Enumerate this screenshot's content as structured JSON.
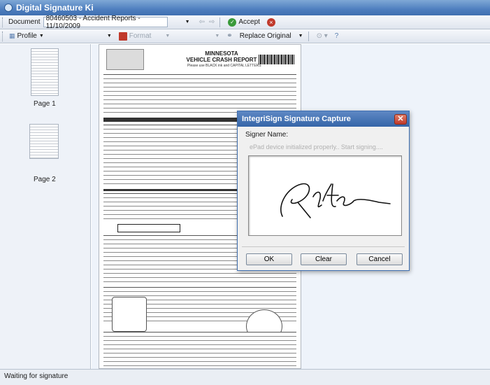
{
  "window": {
    "title": "Digital Signature Ki"
  },
  "toolbar1": {
    "document_label": "Document",
    "document_value": "80460503 - Accident Reports - 11/10/2009",
    "accept_label": "Accept"
  },
  "toolbar2": {
    "profile_label": "Profile",
    "format_label": "Format",
    "replace_label": "Replace Original"
  },
  "sidebar": {
    "pages": [
      {
        "label": "Page 1"
      },
      {
        "label": "Page 2"
      }
    ]
  },
  "document": {
    "title_line1": "MINNESOTA",
    "title_line2": "VEHICLE CRASH REPORT",
    "subtitle": "Please use BLACK ink and CAPITAL LETTERS"
  },
  "dialog": {
    "title": "IntegriSign Signature Capture",
    "signer_label": "Signer Name:",
    "status_message": "ePad device initialized properly.. Start signing....",
    "ok_label": "OK",
    "clear_label": "Clear",
    "cancel_label": "Cancel"
  },
  "statusbar": {
    "text": "Waiting for signature"
  },
  "colors": {
    "accent": "#3f6fb0",
    "accept_green": "#3a9a3a",
    "close_red": "#c0392b"
  }
}
